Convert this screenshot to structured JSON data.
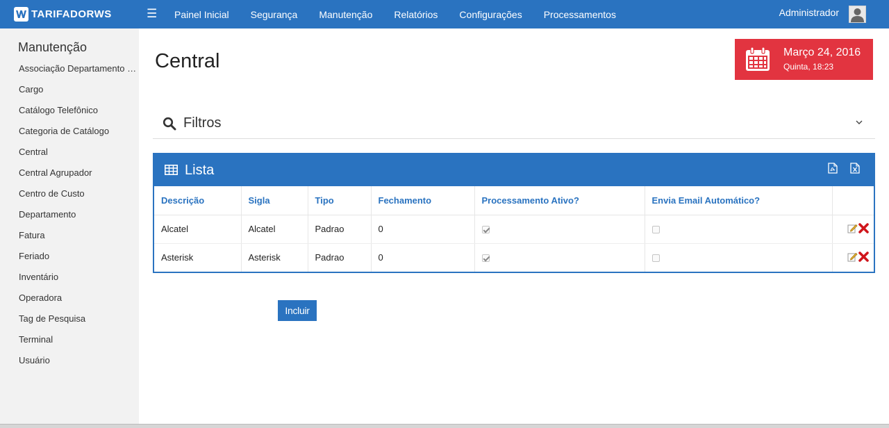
{
  "header": {
    "logo_text": "TARIFADORWS",
    "nav": [
      "Painel Inicial",
      "Segurança",
      "Manutenção",
      "Relatórios",
      "Configurações",
      "Processamentos"
    ],
    "user": "Administrador"
  },
  "sidebar": {
    "title": "Manutenção",
    "items": [
      "Associação Departamento Central",
      "Cargo",
      "Catálogo Telefônico",
      "Categoria de Catálogo",
      "Central",
      "Central Agrupador",
      "Centro de Custo",
      "Departamento",
      "Fatura",
      "Feriado",
      "Inventário",
      "Operadora",
      "Tag de Pesquisa",
      "Terminal",
      "Usuário"
    ]
  },
  "page": {
    "title": "Central",
    "date_main": "Março 24, 2016",
    "date_sub": "Quinta, 18:23"
  },
  "filters": {
    "label": "Filtros"
  },
  "list": {
    "title": "Lista",
    "columns": [
      "Descrição",
      "Sigla",
      "Tipo",
      "Fechamento",
      "Processamento Ativo?",
      "Envia Email Automático?",
      ""
    ],
    "rows": [
      {
        "descricao": "Alcatel",
        "sigla": "Alcatel",
        "tipo": "Padrao",
        "fechamento": "0",
        "processamento_ativo": true,
        "envia_email": false
      },
      {
        "descricao": "Asterisk",
        "sigla": "Asterisk",
        "tipo": "Padrao",
        "fechamento": "0",
        "processamento_ativo": true,
        "envia_email": false
      }
    ]
  },
  "buttons": {
    "incluir": "Incluir"
  },
  "colors": {
    "primary": "#2a73c0",
    "date_card": "#e23440",
    "sidebar_bg": "#f2f2f2",
    "delete": "#d0161c"
  },
  "icons": [
    "bars-icon",
    "calendar-icon",
    "search-icon",
    "chevron-down-icon",
    "table-icon",
    "file-pdf-icon",
    "file-excel-icon",
    "edit-icon",
    "delete-icon"
  ]
}
